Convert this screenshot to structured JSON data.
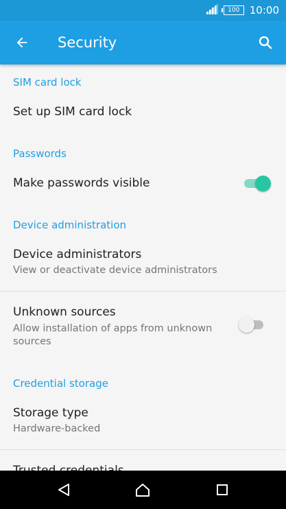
{
  "status_bar": {
    "battery": "100",
    "time": "10:00"
  },
  "app_bar": {
    "title": "Security"
  },
  "sections": {
    "sim": {
      "header": "SIM card lock",
      "setup_title": "Set up SIM card lock"
    },
    "passwords": {
      "header": "Passwords",
      "visible_title": "Make passwords visible",
      "visible_enabled": true
    },
    "device_admin": {
      "header": "Device administration",
      "admins_title": "Device administrators",
      "admins_sub": "View or deactivate device administrators",
      "unknown_title": "Unknown sources",
      "unknown_sub": "Allow installation of apps from unknown sources",
      "unknown_enabled": false
    },
    "credential": {
      "header": "Credential storage",
      "storage_title": "Storage type",
      "storage_sub": "Hardware-backed",
      "trusted_title": "Trusted credentials"
    }
  },
  "colors": {
    "app_bar": "#1e9ee3",
    "status_bar": "#1d98d7",
    "accent": "#1e9ee3",
    "toggle_on_track": "#84d9c6",
    "toggle_on_thumb": "#26c6a3",
    "toggle_off_track": "#bdbdbd",
    "toggle_off_thumb": "#f1f1f1"
  }
}
